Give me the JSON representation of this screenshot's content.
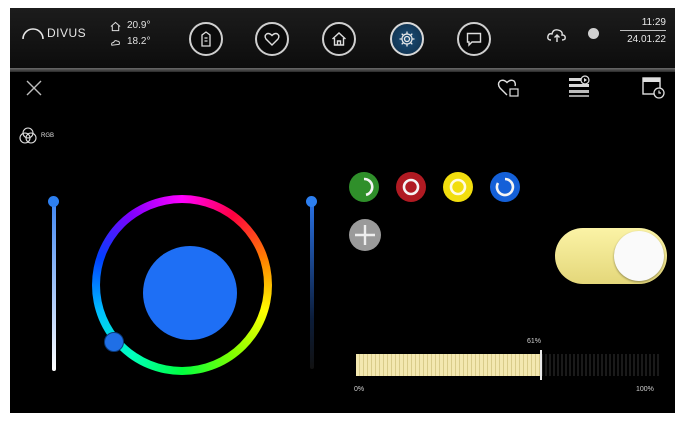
{
  "header": {
    "brand": "DIVUS",
    "temperatures": {
      "indoor": "20.9°",
      "outdoor": "18.2°"
    },
    "nav_icons": [
      "building-icon",
      "heart-icon",
      "home-icon",
      "settings-icon",
      "chat-icon"
    ],
    "active_nav": "settings-icon",
    "status": {
      "cloud_icon": "cloud-upload-icon",
      "status_dot": "gray"
    },
    "time": "11:29",
    "date": "24.01.22"
  },
  "panel": {
    "toolbar": [
      "close-icon",
      "favorite-icon",
      "scene-icon",
      "schedule-icon"
    ],
    "mode_label": "RGB",
    "color": {
      "current": "#1e6ff5"
    },
    "presets": [
      {
        "name": "green",
        "color": "#2f8f2a"
      },
      {
        "name": "red",
        "color": "#b01a22"
      },
      {
        "name": "yellow",
        "color": "#f2de0e"
      },
      {
        "name": "blue",
        "color": "#1460d8"
      }
    ],
    "add_preset_icon": "plus-icon",
    "switch": {
      "state": "on"
    },
    "dimmer": {
      "value_label": "61%",
      "value": 0.61,
      "min_label": "0%",
      "max_label": "100%"
    }
  }
}
